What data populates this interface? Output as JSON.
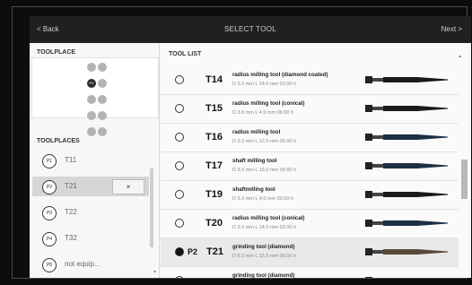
{
  "nav": {
    "back_label": "< Back",
    "title": "SELECT TOOL",
    "next_label": "Next >"
  },
  "toolplace": {
    "title": "TOOLPLACE",
    "active_label": "P2"
  },
  "toolplaces": {
    "title": "TOOLPLACES",
    "items": [
      {
        "id": "P1",
        "label": "T11",
        "selected": false
      },
      {
        "id": "P2",
        "label": "T21",
        "selected": true,
        "clear_label": "×"
      },
      {
        "id": "P3",
        "label": "T22",
        "selected": false
      },
      {
        "id": "P4",
        "label": "T32",
        "selected": false
      },
      {
        "id": "P5",
        "label": "not equip...",
        "selected": false
      }
    ]
  },
  "tool_list": {
    "title": "TOOL LIST",
    "items": [
      {
        "id": "T14",
        "name": "radius milling tool (diamond coated)",
        "dims": "D 3.0 mm L 14.0 mm 01:00 h",
        "tool_color": "#1a1a1a"
      },
      {
        "id": "T15",
        "name": "radius milling tool (conical)",
        "dims": "D 3.0 mm L 4.0 mm 06:00 h",
        "tool_color": "#1a1a1a"
      },
      {
        "id": "T16",
        "name": "radius milling tool",
        "dims": "D 3.0 mm L 12.0 mm 06:00 h",
        "tool_color": "#1d2e45"
      },
      {
        "id": "T17",
        "name": "shaft milling tool",
        "dims": "D 3.0 mm L 15.0 mm 06:00 h",
        "tool_color": "#1d2e45"
      },
      {
        "id": "T19",
        "name": "shaftmilling tool",
        "dims": "D 3.0 mm L 4.0 mm 02:00 h",
        "tool_color": "#1a1a1a"
      },
      {
        "id": "T20",
        "name": "radius milling tool (conical)",
        "dims": "D 3.0 mm L 14.0 mm 02:00 h",
        "tool_color": "#1d2e45"
      },
      {
        "id": "T21",
        "prefix": "P2",
        "name": "grinding tool (diamond)",
        "dims": "D 5.0 mm L 15.5 mm 06:00 h",
        "tool_color": "#5a4a3a",
        "selected": true
      },
      {
        "id": "",
        "name": "grinding tool (diamond)",
        "dims": "",
        "tool_color": "#1a1a1a"
      }
    ]
  },
  "colors": {
    "topbar": "#202020",
    "selected_row": "#e9e9e9"
  }
}
